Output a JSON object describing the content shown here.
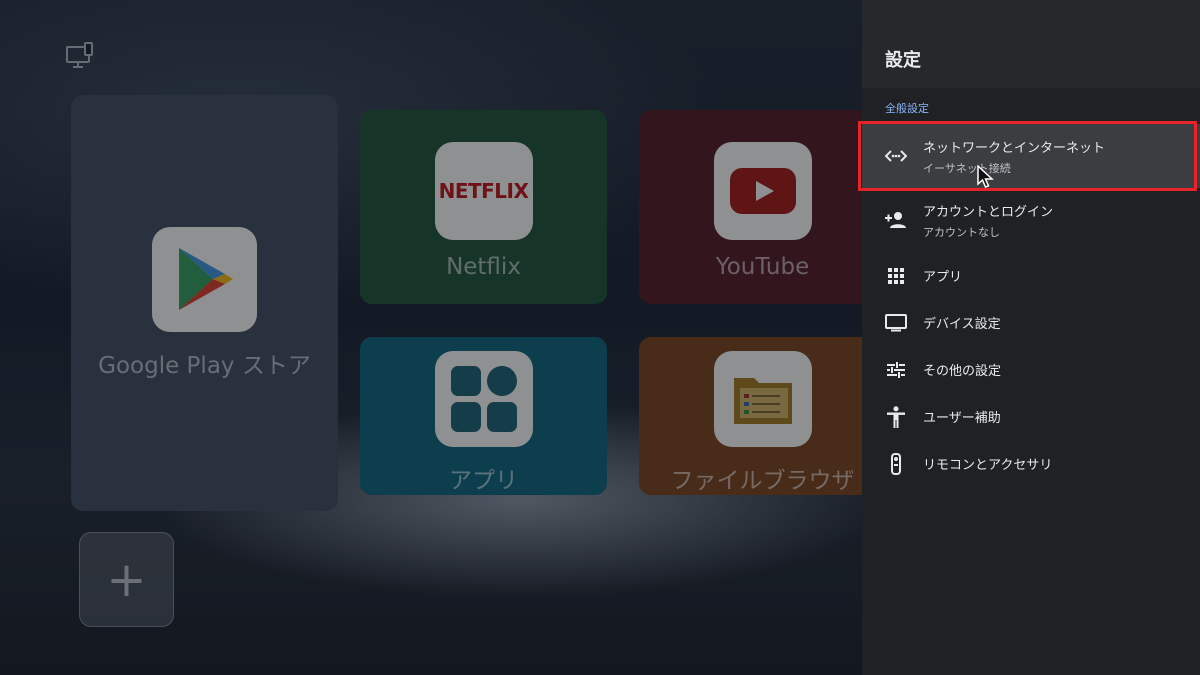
{
  "home": {
    "tiles": {
      "play_store": "Google Play ストア",
      "netflix": "Netflix",
      "netflix_logo": "NETFLIX",
      "youtube": "YouTube",
      "apps": "アプリ",
      "file_browser": "ファイルブラウザ"
    },
    "add_symbol": "+"
  },
  "settings": {
    "title": "設定",
    "section": "全般設定",
    "items": [
      {
        "label": "ネットワークとインターネット",
        "sub": "イーサネット接続",
        "icon": "network-icon",
        "focused": true
      },
      {
        "label": "アカウントとログイン",
        "sub": "アカウントなし",
        "icon": "add-account-icon"
      },
      {
        "label": "アプリ",
        "icon": "apps-grid-icon"
      },
      {
        "label": "デバイス設定",
        "icon": "tv-icon"
      },
      {
        "label": "その他の設定",
        "icon": "tune-icon"
      },
      {
        "label": "ユーザー補助",
        "icon": "accessibility-icon"
      },
      {
        "label": "リモコンとアクセサリ",
        "icon": "remote-icon"
      }
    ]
  },
  "colors": {
    "panel_bg": "#202124",
    "focus_border": "#e8232a",
    "section_blue": "#8ab4f8"
  }
}
